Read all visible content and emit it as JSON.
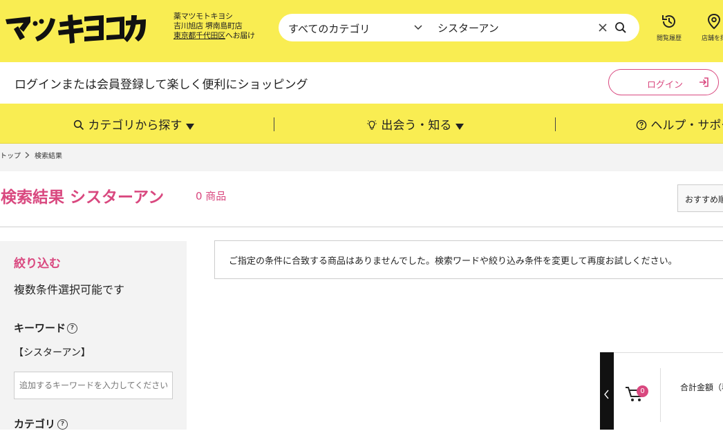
{
  "header": {
    "logo_text": "マツキヨココカラ",
    "store": {
      "line1": "薬マツモトキヨシ",
      "line2": "吉川旭店 堺南島町店",
      "address": "東京都千代田区",
      "address_suffix": "へお届け"
    },
    "search": {
      "category": "すべてのカテゴリ",
      "query": "シスターアン"
    },
    "history_label": "閲覧履歴",
    "store_finder_label": "店舗を探"
  },
  "loginbar": {
    "message": "ログインまたは会員登録して楽しく便利にショッピング",
    "login_label": "ログイン"
  },
  "nav": {
    "items": [
      {
        "label": "カテゴリから探す",
        "icon": "search-icon"
      },
      {
        "label": "出会う・知る",
        "icon": "lightbulb-icon"
      },
      {
        "label": "ヘルプ・サポー",
        "icon": "question-circle-icon"
      }
    ]
  },
  "breadcrumb": {
    "home": "トップ",
    "current": "検索結果"
  },
  "results": {
    "title": "検索結果 シスターアン",
    "count": "0 商品",
    "sort_label": "おすすめ順",
    "notice": "ご指定の条件に合致する商品はありませんでした。検索ワードや絞り込み条件を変更して再度お試しください。"
  },
  "sidebar": {
    "heading": "絞り込む",
    "subtitle": "複数条件選択可能です",
    "keyword_label": "キーワード",
    "keyword_value": "【シスターアン】",
    "keyword_placeholder": "追加するキーワードを入力してください",
    "category_label": "カテゴリ",
    "help_glyph": "?"
  },
  "cart": {
    "count": "0",
    "total_label": "合計金額（税"
  },
  "colors": {
    "brand_yellow": "#f9ed52",
    "accent_pink": "#d9487f"
  }
}
